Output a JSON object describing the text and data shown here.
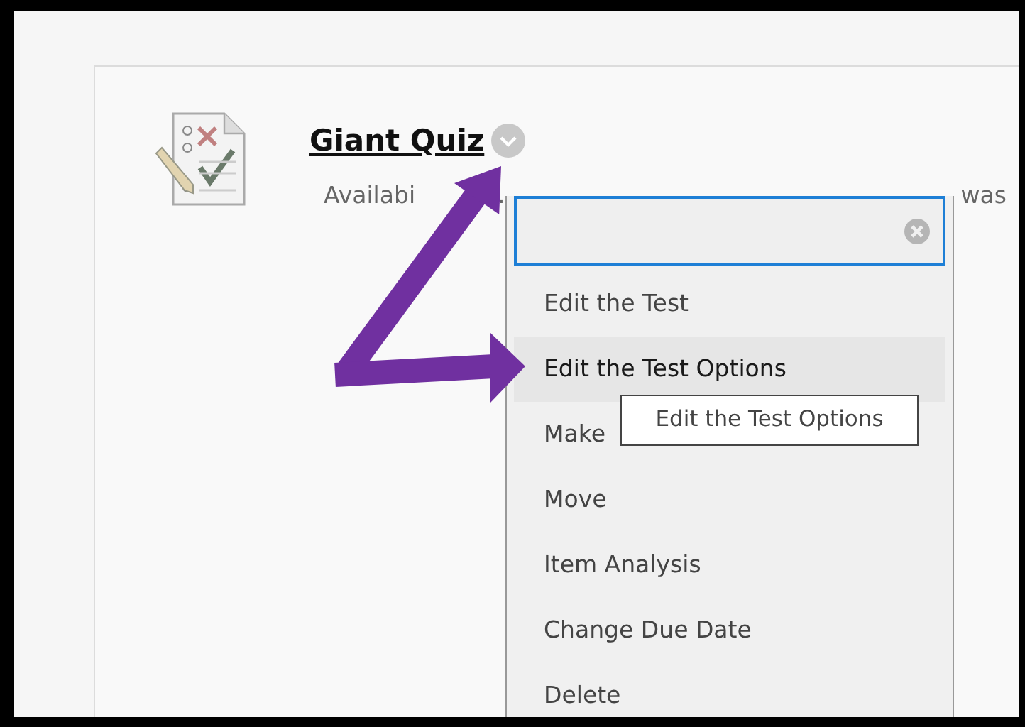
{
  "content_item": {
    "title": "Giant Quiz",
    "availability_fragments": [
      "Availabi",
      "."
    ],
    "trailing_text": "was"
  },
  "menu": {
    "items": [
      {
        "label": "Edit the Test",
        "selected": false
      },
      {
        "label": "Edit the Test Options",
        "selected": true
      },
      {
        "label": "Make",
        "selected": false
      },
      {
        "label": "Move",
        "selected": false
      },
      {
        "label": "Item Analysis",
        "selected": false
      },
      {
        "label": "Change Due Date",
        "selected": false
      },
      {
        "label": "Delete",
        "selected": false
      }
    ]
  },
  "tooltip": {
    "text": "Edit the Test Options"
  }
}
